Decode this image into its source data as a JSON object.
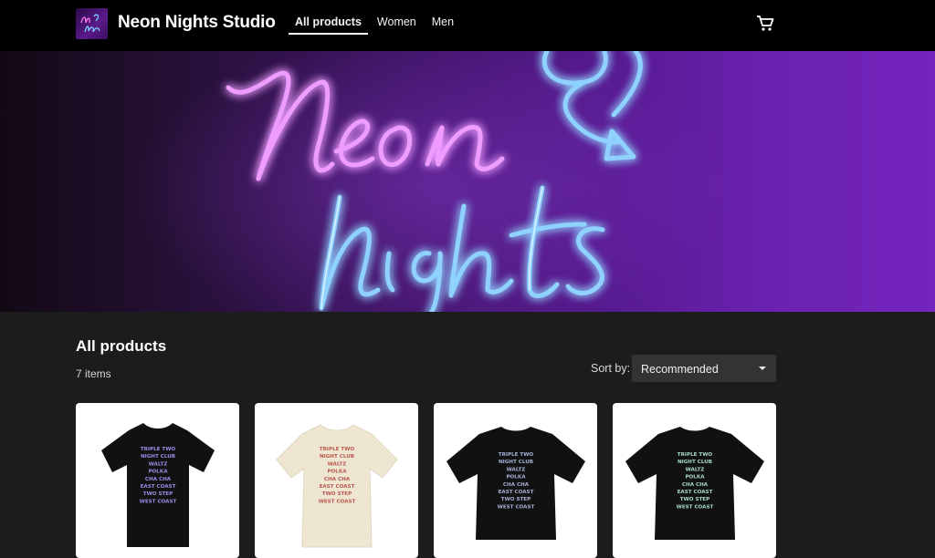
{
  "header": {
    "brand": "Neon Nights Studio",
    "logo_icon": "neon-nights-logo",
    "nav": [
      {
        "label": "All products",
        "active": true
      },
      {
        "label": "Women",
        "active": false
      },
      {
        "label": "Men",
        "active": false
      }
    ],
    "cart_icon": "shopping-cart-icon"
  },
  "hero": {
    "sign_text": [
      "Neon",
      "nights"
    ],
    "colors": {
      "pink": "#e27bff",
      "blue": "#7fc7ff",
      "purple": "#6a21b0"
    }
  },
  "products": {
    "title": "All products",
    "count": "7 items",
    "sort": {
      "label": "Sort by:",
      "value": "Recommended"
    },
    "items": [
      {
        "shirt_color": "#111111",
        "text_color": "#9a8be8",
        "lines": [
          "TRIPLE TWO",
          "NIGHT CLUB",
          "WALTZ",
          "POLKA",
          "CHA CHA",
          "EAST COAST",
          "TWO STEP",
          "WEST COAST"
        ]
      },
      {
        "shirt_color": "#efe6d2",
        "text_color": "#b8584f",
        "lines": [
          "TRIPLE TWO",
          "NIGHT CLUB",
          "WALTZ",
          "POLKA",
          "CHA CHA",
          "EAST COAST",
          "TWO STEP",
          "WEST COAST"
        ]
      },
      {
        "shirt_color": "#111111",
        "text_color": "#a7b0d8",
        "lines": [
          "TRIPLE TWO",
          "NIGHT CLUB",
          "WALTZ",
          "POLKA",
          "CHA CHA",
          "EAST COAST",
          "TWO STEP",
          "WEST COAST"
        ]
      },
      {
        "shirt_color": "#111111",
        "text_color": "#a6dcc8",
        "lines": [
          "TRIPLE TWO",
          "NIGHT CLUB",
          "WALTZ",
          "POLKA",
          "CHA CHA",
          "EAST COAST",
          "TWO STEP",
          "WEST COAST"
        ]
      }
    ]
  }
}
